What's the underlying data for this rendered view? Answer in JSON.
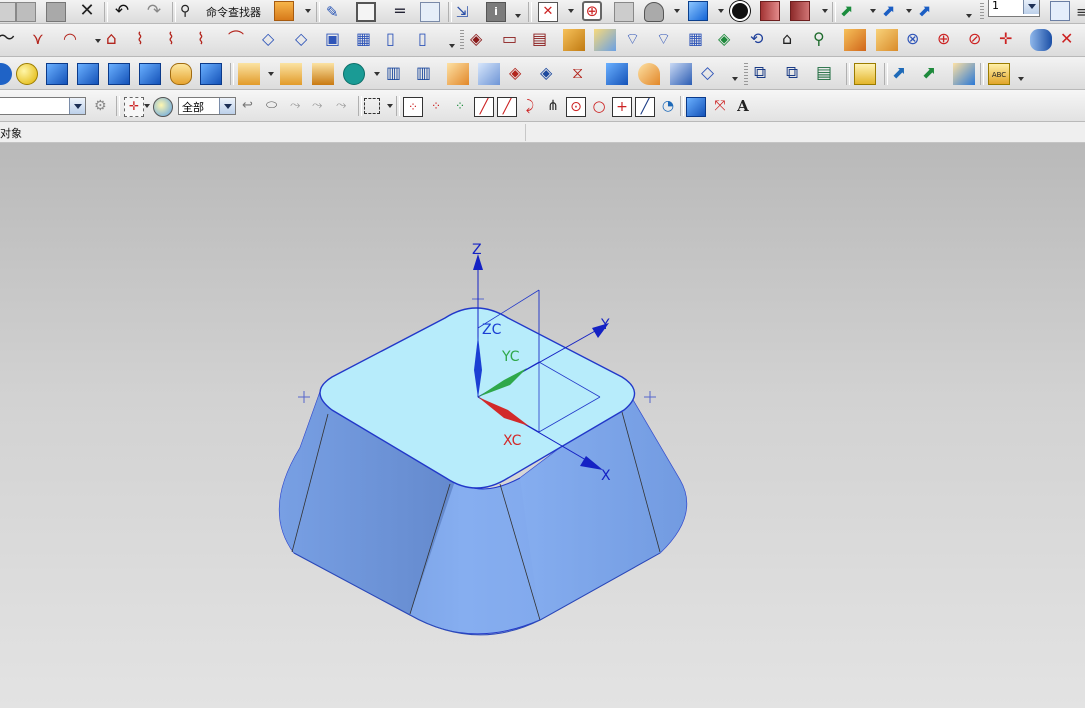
{
  "toolbar1": {
    "command_finder_label": "命令查找器",
    "layer_value": "1"
  },
  "toolbar4": {
    "filter_value": "",
    "selection_scope_value": "全部",
    "text_tool_label": "A"
  },
  "statusbar": {
    "prompt": "对象"
  },
  "viewport": {
    "triad_labels": {
      "z": "Z",
      "y": "Y",
      "x": "X"
    },
    "wcs_labels": {
      "zc": "ZC",
      "yc": "YC",
      "xc": "XC"
    },
    "colors": {
      "top_face": "#b7ecfb",
      "side_face": "#7da6ea",
      "side_face_dark": "#6a8fd4",
      "edge": "#2238c9",
      "xc_axis": "#d22a2a",
      "yc_axis": "#2fa84a",
      "zc_axis": "#1b3fd3",
      "triad": "#1522c4"
    }
  },
  "icons": [
    "copy-icon",
    "paste-icon",
    "delete-icon",
    "undo-icon",
    "redo-icon",
    "command-finder-icon",
    "book-icon",
    "edit-object-icon",
    "layer-icon",
    "wcs-icon",
    "info-icon",
    "snap-icon",
    "view-icon",
    "shade-icon",
    "render-icon",
    "fit-icon",
    "color-icon",
    "sketch-icons",
    "feature-icons",
    "surface-icons",
    "selection-icons"
  ]
}
